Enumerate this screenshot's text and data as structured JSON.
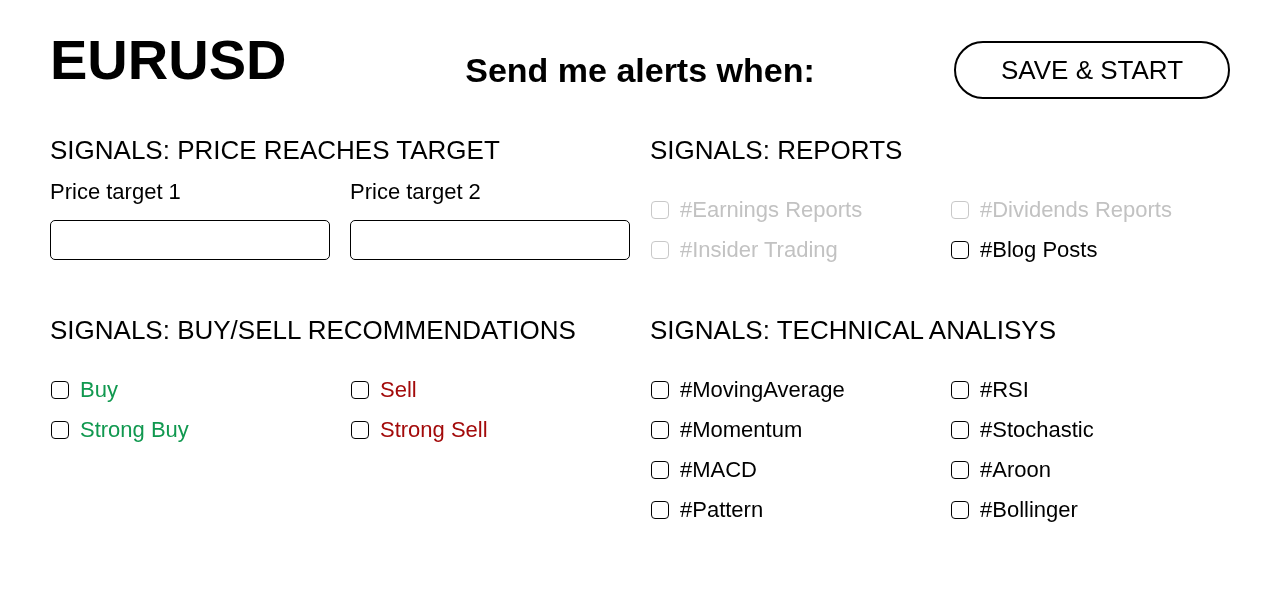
{
  "header": {
    "symbol": "EURUSD",
    "prompt": "Send me alerts when:",
    "save_button": "SAVE & START"
  },
  "sections": [
    {
      "kind": "fields",
      "title": "SIGNALS: PRICE REACHES TARGET",
      "fields": [
        {
          "label": "Price target 1"
        },
        {
          "label": "Price target 2"
        }
      ]
    },
    {
      "kind": "options",
      "title": "SIGNALS: REPORTS",
      "options": [
        {
          "label": "#Earnings Reports",
          "checked": false,
          "disabled": true
        },
        {
          "label": "#Dividends Reports",
          "checked": false,
          "disabled": true
        },
        {
          "label": "#Insider Trading",
          "checked": false,
          "disabled": true
        },
        {
          "label": "#Blog Posts",
          "checked": false,
          "disabled": false
        }
      ]
    },
    {
      "kind": "options",
      "title": "SIGNALS: BUY/SELL RECOMMENDATIONS",
      "options": [
        {
          "label": "Buy",
          "checked": false,
          "color": "#10984f"
        },
        {
          "label": "Sell",
          "checked": false,
          "color": "#a30a0a"
        },
        {
          "label": "Strong Buy",
          "checked": false,
          "color": "#10984f"
        },
        {
          "label": "Strong Sell",
          "checked": false,
          "color": "#a30a0a"
        }
      ]
    },
    {
      "kind": "options",
      "title": "SIGNALS: TECHNICAL ANALISYS",
      "options": [
        {
          "label": "#MovingAverage",
          "checked": false
        },
        {
          "label": "#RSI",
          "checked": false
        },
        {
          "label": "#Momentum",
          "checked": false
        },
        {
          "label": "#Stochastic",
          "checked": false
        },
        {
          "label": "#MACD",
          "checked": false
        },
        {
          "label": "#Aroon",
          "checked": false
        },
        {
          "label": "#Pattern",
          "checked": false
        },
        {
          "label": "#Bollinger",
          "checked": false
        }
      ]
    }
  ]
}
